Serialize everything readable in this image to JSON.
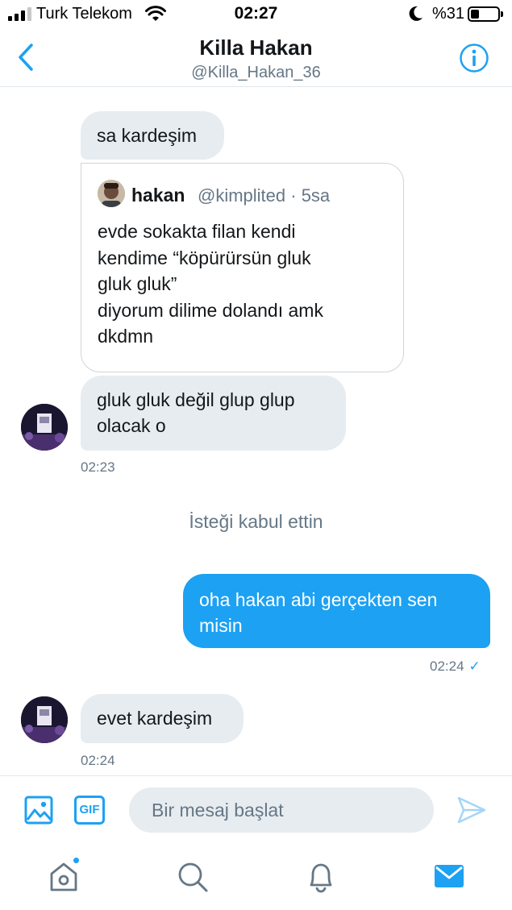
{
  "status_bar": {
    "carrier": "Turk Telekom",
    "time": "02:27",
    "battery": "%31",
    "battery_level": 0.31,
    "signal_bars": 3
  },
  "header": {
    "title": "Killa Hakan",
    "handle": "@Killa_Hakan_36",
    "back_icon": "chevron-left-icon",
    "info_icon": "info-icon",
    "accent_color": "#1da1f2"
  },
  "messages": [
    {
      "direction": "incoming",
      "text": "sa kardeşim"
    },
    {
      "direction": "incoming",
      "type": "quoted-tweet",
      "author_name": "hakan",
      "author_meta": "@kimplited · 5sa",
      "text": "evde sokakta filan kendi\nkendime “köpürürsün gluk\ngluk gluk”\ndiyorum dilime dolandı amk\ndkdmn"
    },
    {
      "direction": "incoming",
      "text": "gluk gluk değil glup glup olacak o",
      "time": "02:23"
    },
    {
      "type": "system",
      "text": "İsteği kabul ettin"
    },
    {
      "direction": "outgoing",
      "text": "oha hakan abi gerçekten sen misin",
      "time": "02:24",
      "read_mark": "✓"
    },
    {
      "direction": "incoming",
      "text": "evet kardeşim",
      "time": "02:24"
    }
  ],
  "composer": {
    "placeholder": "Bir mesaj başlat",
    "gif_label": "GIF",
    "image_icon": "image-icon",
    "send_icon": "send-icon"
  },
  "tab_bar": {
    "items": [
      "home-icon",
      "search-icon",
      "notifications-icon",
      "messages-icon"
    ],
    "active": "messages-icon"
  }
}
